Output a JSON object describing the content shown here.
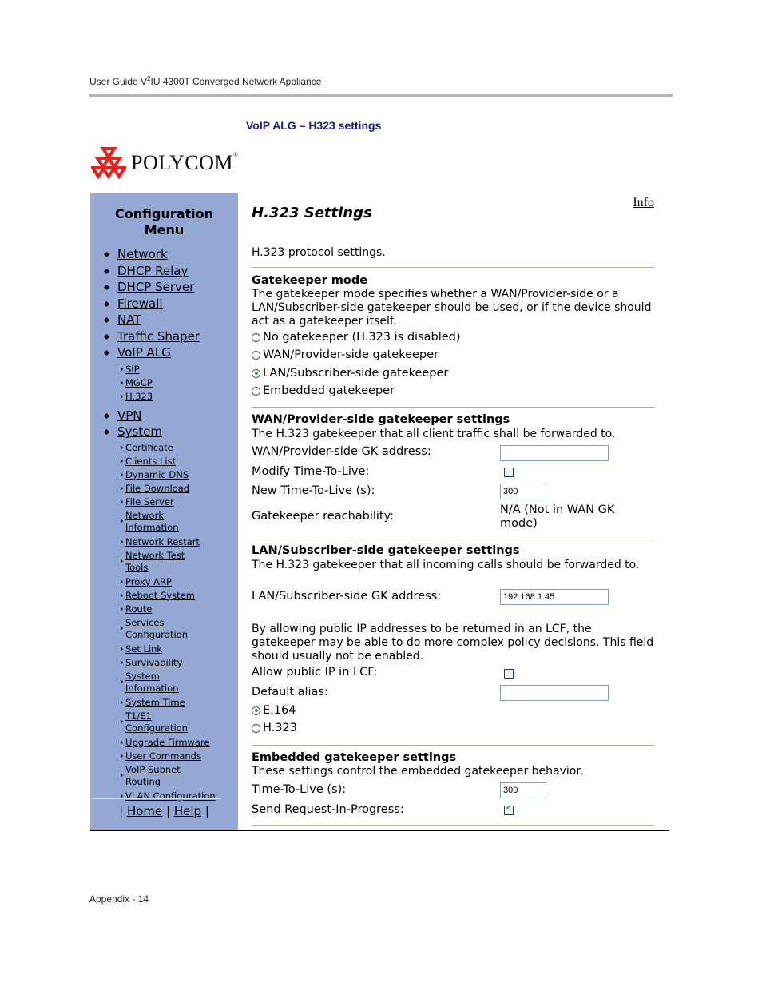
{
  "document": {
    "header_prefix": "User Guide V",
    "header_sup": "2",
    "header_suffix": "IU 4300T Converged Network Appliance",
    "caption": "VoIP ALG – H323 settings",
    "logo_text": "POLYCOM",
    "logo_mark": "®",
    "footer": "Appendix - 14",
    "brand_color": "#e8211c",
    "caption_color": "#1a1a8c"
  },
  "sidebar": {
    "title_line1": "Configuration",
    "title_line2": "Menu",
    "background": "#94a8d6",
    "items": [
      {
        "label": "Network"
      },
      {
        "label": "DHCP Relay"
      },
      {
        "label": "DHCP Server"
      },
      {
        "label": "Firewall"
      },
      {
        "label": "NAT"
      },
      {
        "label": "Traffic Shaper"
      },
      {
        "label": "VoIP ALG",
        "children": [
          "SIP",
          "MGCP",
          "H.323"
        ]
      },
      {
        "label": "VPN"
      },
      {
        "label": "System",
        "children": [
          "Certificate",
          "Clients List",
          "Dynamic DNS",
          "File Download",
          "File Server",
          "Network Information",
          "Network Restart",
          "Network Test Tools",
          "Proxy ARP",
          "Reboot System",
          "Route",
          "Services Configuration",
          "Set Link",
          "Survivability",
          "System Information",
          "System Time",
          "T1/E1 Configuration",
          "Upgrade Firmware",
          "User Commands",
          "VoIP Subnet Routing",
          "VLAN Configuration"
        ]
      }
    ],
    "footer": {
      "sep": "|",
      "home": "Home",
      "help": "Help"
    }
  },
  "main": {
    "info_link": "Info",
    "title": "H.323 Settings",
    "intro": "H.323 protocol settings.",
    "gatekeeper_mode": {
      "heading": "Gatekeeper mode",
      "description": "The gatekeeper mode specifies whether a WAN/Provider-side or a LAN/Subscriber-side gatekeeper should be used, or if the device should act as a gatekeeper itself.",
      "options": [
        {
          "label": "No gatekeeper (H.323 is disabled)",
          "checked": false
        },
        {
          "label": "WAN/Provider-side gatekeeper",
          "checked": false
        },
        {
          "label": "LAN/Subscriber-side gatekeeper",
          "checked": true
        },
        {
          "label": "Embedded gatekeeper",
          "checked": false
        }
      ]
    },
    "wan_settings": {
      "heading": "WAN/Provider-side gatekeeper settings",
      "description": "The H.323 gatekeeper that all client traffic shall be forwarded to.",
      "gk_address_label": "WAN/Provider-side GK address:",
      "gk_address_value": "",
      "modify_ttl_label": "Modify Time-To-Live:",
      "modify_ttl_checked": false,
      "new_ttl_label": "New Time-To-Live (s):",
      "new_ttl_value": "300",
      "reachability_label": "Gatekeeper reachability:",
      "reachability_value": "N/A (Not in WAN GK mode)"
    },
    "lan_settings": {
      "heading": "LAN/Subscriber-side gatekeeper settings",
      "description": "The H.323 gatekeeper that all incoming calls should be forwarded to.",
      "gk_address_label": "LAN/Subscriber-side GK address:",
      "gk_address_value": "192.168.1.45",
      "lcf_description": "By allowing public IP addresses to be returned in an LCF, the gatekeeper may be able to do more complex policy decisions. This field should usually not be enabled.",
      "allow_public_ip_label": "Allow public IP in LCF:",
      "allow_public_ip_checked": false,
      "default_alias_label": "Default alias:",
      "default_alias_value": "",
      "alias_options": [
        {
          "label": "E.164",
          "checked": true
        },
        {
          "label": "H.323",
          "checked": false
        }
      ]
    },
    "embedded_settings": {
      "heading": "Embedded gatekeeper settings",
      "description": "These settings control the embedded gatekeeper behavior.",
      "ttl_label": "Time-To-Live (s):",
      "ttl_value": "300",
      "rip_label": "Send Request-In-Progress:",
      "rip_checked": true
    }
  }
}
